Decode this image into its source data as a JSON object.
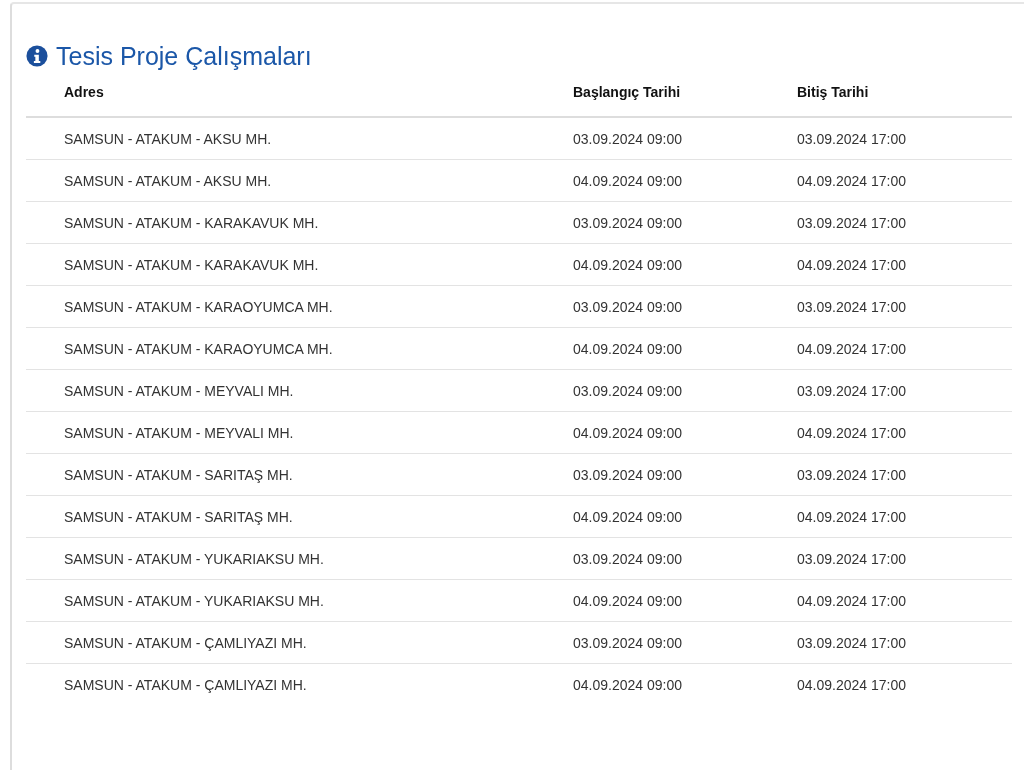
{
  "panel": {
    "title": "Tesis Proje Çalışmaları"
  },
  "table": {
    "columns": [
      "Adres",
      "Başlangıç Tarihi",
      "Bitiş Tarihi"
    ],
    "rows": [
      [
        "SAMSUN - ATAKUM - AKSU MH.",
        "03.09.2024 09:00",
        "03.09.2024 17:00"
      ],
      [
        "SAMSUN - ATAKUM - AKSU MH.",
        "04.09.2024 09:00",
        "04.09.2024 17:00"
      ],
      [
        "SAMSUN - ATAKUM - KARAKAVUK MH.",
        "03.09.2024 09:00",
        "03.09.2024 17:00"
      ],
      [
        "SAMSUN - ATAKUM - KARAKAVUK MH.",
        "04.09.2024 09:00",
        "04.09.2024 17:00"
      ],
      [
        "SAMSUN - ATAKUM - KARAOYUMCA MH.",
        "03.09.2024 09:00",
        "03.09.2024 17:00"
      ],
      [
        "SAMSUN - ATAKUM - KARAOYUMCA MH.",
        "04.09.2024 09:00",
        "04.09.2024 17:00"
      ],
      [
        "SAMSUN - ATAKUM - MEYVALI MH.",
        "03.09.2024 09:00",
        "03.09.2024 17:00"
      ],
      [
        "SAMSUN - ATAKUM - MEYVALI MH.",
        "04.09.2024 09:00",
        "04.09.2024 17:00"
      ],
      [
        "SAMSUN - ATAKUM - SARITAŞ MH.",
        "03.09.2024 09:00",
        "03.09.2024 17:00"
      ],
      [
        "SAMSUN - ATAKUM - SARITAŞ MH.",
        "04.09.2024 09:00",
        "04.09.2024 17:00"
      ],
      [
        "SAMSUN - ATAKUM - YUKARIAKSU MH.",
        "03.09.2024 09:00",
        "03.09.2024 17:00"
      ],
      [
        "SAMSUN - ATAKUM - YUKARIAKSU MH.",
        "04.09.2024 09:00",
        "04.09.2024 17:00"
      ],
      [
        "SAMSUN - ATAKUM - ÇAMLIYAZI MH.",
        "03.09.2024 09:00",
        "03.09.2024 17:00"
      ],
      [
        "SAMSUN - ATAKUM - ÇAMLIYAZI MH.",
        "04.09.2024 09:00",
        "04.09.2024 17:00"
      ]
    ]
  }
}
